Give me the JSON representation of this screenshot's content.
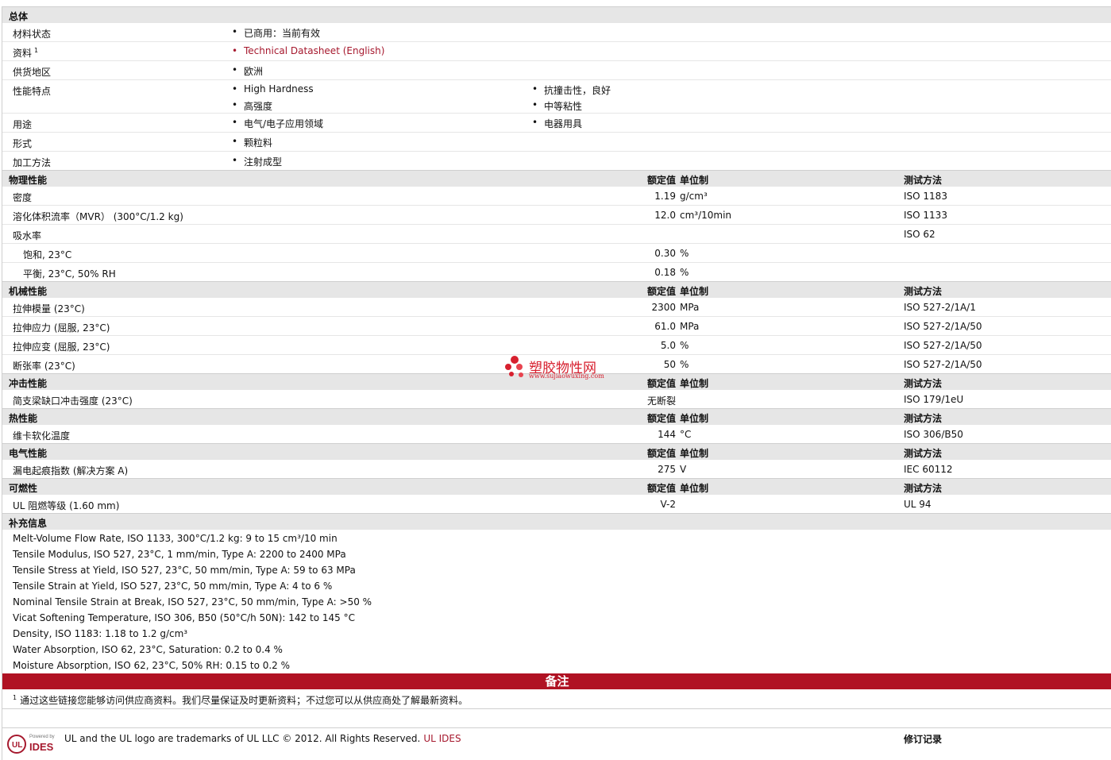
{
  "general": {
    "title": "总体",
    "material_status": {
      "label": "材料状态",
      "value": "已商用：当前有效"
    },
    "literature": {
      "label": "资料",
      "sup": "1",
      "value": "Technical Datasheet (English)"
    },
    "availability": {
      "label": "供货地区",
      "value": "欧洲"
    },
    "features": {
      "label": "性能特点",
      "items": [
        "High Hardness",
        "抗撞击性，良好",
        "高强度",
        "中等粘性"
      ]
    },
    "uses": {
      "label": "用途",
      "items": [
        "电气/电子应用领域",
        "电器用具"
      ]
    },
    "forms": {
      "label": "形式",
      "value": "颗粒料"
    },
    "processing": {
      "label": "加工方法",
      "value": "注射成型"
    }
  },
  "headers": {
    "nominal": "额定值",
    "unit": "单位制",
    "method": "测试方法"
  },
  "physical": {
    "title": "物理性能",
    "rows": [
      {
        "label": "密度",
        "value": "1.19",
        "unit": "g/cm³",
        "method": "ISO 1183"
      },
      {
        "label": "溶化体积流率（MVR） (300°C/1.2 kg)",
        "value": "12.0",
        "unit": "cm³/10min",
        "method": "ISO 1133"
      },
      {
        "label": "吸水率",
        "value": "",
        "unit": "",
        "method": "ISO 62"
      },
      {
        "label": "饱和, 23°C",
        "value": "0.30",
        "unit": "%",
        "method": ""
      },
      {
        "label": "平衡, 23°C, 50% RH",
        "value": "0.18",
        "unit": "%",
        "method": ""
      }
    ]
  },
  "mechanical": {
    "title": "机械性能",
    "rows": [
      {
        "label": "拉伸模量 (23°C)",
        "value": "2300",
        "unit": "MPa",
        "method": "ISO 527-2/1A/1"
      },
      {
        "label": "拉伸应力 (屈服, 23°C)",
        "value": "61.0",
        "unit": "MPa",
        "method": "ISO 527-2/1A/50"
      },
      {
        "label": "拉伸应变 (屈服, 23°C)",
        "value": "5.0",
        "unit": "%",
        "method": "ISO 527-2/1A/50"
      },
      {
        "label": "断张率 (23°C)",
        "value": "50",
        "unit": "%",
        "method": "ISO 527-2/1A/50"
      }
    ]
  },
  "impact": {
    "title": "冲击性能",
    "rows": [
      {
        "label": "简支梁缺口冲击强度 (23°C)",
        "value": "无断裂",
        "unit": "",
        "method": "ISO 179/1eU"
      }
    ]
  },
  "thermal": {
    "title": "热性能",
    "rows": [
      {
        "label": "维卡软化温度",
        "value": "144",
        "unit": "°C",
        "method": "ISO 306/B50"
      }
    ]
  },
  "electrical": {
    "title": "电气性能",
    "rows": [
      {
        "label": "漏电起痕指数 (解决方案 A)",
        "value": "275",
        "unit": "V",
        "method": "IEC 60112"
      }
    ]
  },
  "flammability": {
    "title": "可燃性",
    "rows": [
      {
        "label": "UL 阻燃等级 (1.60 mm)",
        "value": "V-2",
        "unit": "",
        "method": "UL 94"
      }
    ]
  },
  "supplemental": {
    "title": "补充信息",
    "lines": [
      "Melt-Volume Flow Rate, ISO 1133, 300°C/1.2 kg: 9 to 15 cm³/10 min",
      "Tensile Modulus, ISO 527, 23°C, 1 mm/min, Type A: 2200 to 2400 MPa",
      "Tensile Stress at Yield, ISO 527, 23°C, 50 mm/min, Type A: 59 to 63 MPa",
      "Tensile Strain at Yield, ISO 527, 23°C, 50 mm/min, Type A: 4 to 6 %",
      "Nominal Tensile Strain at Break, ISO 527, 23°C, 50 mm/min, Type A: >50 %",
      "Vicat Softening Temperature, ISO 306, B50 (50°C/h 50N): 142 to 145 °C",
      "Density, ISO 1183: 1.18 to 1.2 g/cm³",
      "Water Absorption, ISO 62, 23°C, Saturation: 0.2 to 0.4 %",
      "Moisture Absorption, ISO 62, 23°C, 50% RH: 0.15 to 0.2 %"
    ]
  },
  "notes": {
    "title": "备注",
    "footnote_sup": "1",
    "footnote": "通过这些链接您能够访问供应商资料。我们尽量保证及时更新资料；不过您可以从供应商处了解最新资料。"
  },
  "footer": {
    "logo_caption": "Powered by",
    "logo_text": "IDES",
    "trademark": "UL and the UL logo are trademarks of UL LLC © 2012. All Rights Reserved.",
    "ul_ides_link": "UL IDES",
    "revision_label": "修订记录"
  },
  "watermark": {
    "text": "塑胶物性网",
    "url": "www.sujiaowuxing.com"
  },
  "colors": {
    "accent": "#a6192e",
    "notes_bar": "#b01223",
    "section_bg": "#e6e6e6"
  }
}
